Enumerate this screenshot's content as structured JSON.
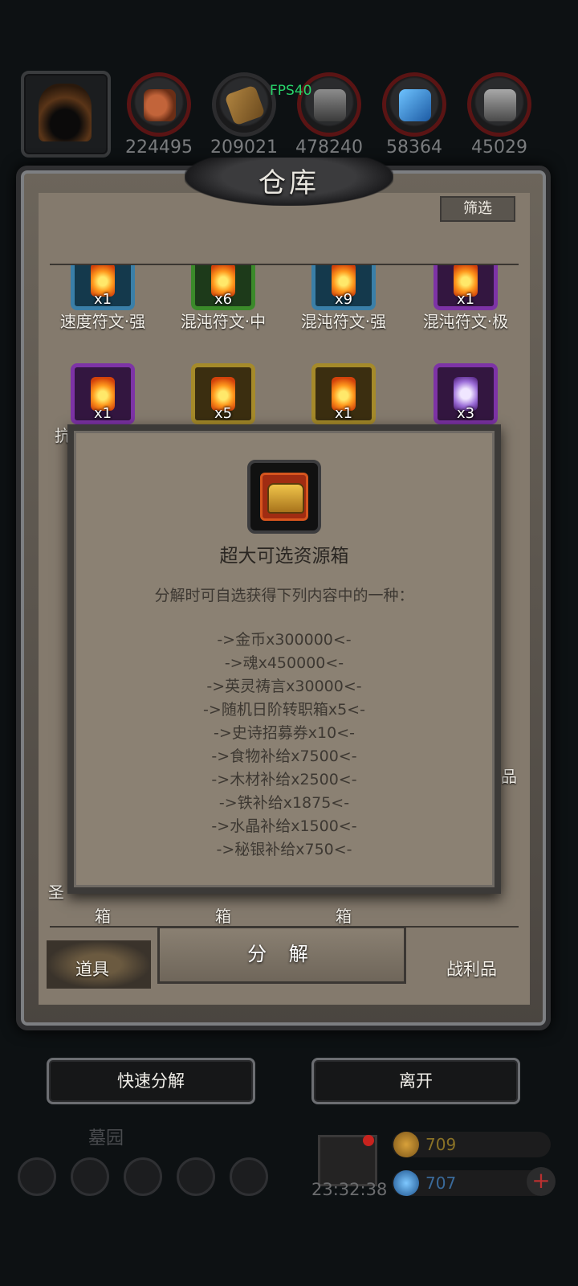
{
  "fps": "FPS40",
  "resources": [
    {
      "icon": "meat-icon",
      "count": "224495"
    },
    {
      "icon": "wood-icon",
      "count": "209021"
    },
    {
      "icon": "iron-icon",
      "count": "478240"
    },
    {
      "icon": "crystal-icon",
      "count": "58364"
    },
    {
      "icon": "mithril-icon",
      "count": "45029"
    }
  ],
  "warehouse": {
    "title": "仓库",
    "filter": "筛选",
    "row1": [
      {
        "label": "速度符文·强",
        "qty": "x1"
      },
      {
        "label": "混沌符文·中",
        "qty": "x6"
      },
      {
        "label": "混沌符文·强",
        "qty": "x9"
      },
      {
        "label": "混沌符文·极",
        "qty": "x1"
      }
    ],
    "row2": [
      {
        "qty": "x1"
      },
      {
        "qty": "x5"
      },
      {
        "qty": "x1"
      },
      {
        "qty": "x3"
      }
    ],
    "row2_partial_label": "抗",
    "side_partial_label": "品",
    "saint_partial": "圣",
    "bottom_row_labels": [
      "箱",
      "箱",
      "箱"
    ],
    "tabs": {
      "items": "道具",
      "decompose": "分 解",
      "loot": "战利品"
    }
  },
  "popup": {
    "title": "超大可选资源箱",
    "description": "分解时可自选获得下列内容中的一种：",
    "rewards": [
      "->金币x300000<-",
      "->魂x450000<-",
      "->英灵祷言x30000<-",
      "->随机日阶转职箱x5<-",
      "->史诗招募券x10<-",
      "->食物补给x7500<-",
      "->木材补给x2500<-",
      "->铁补给x1875<-",
      "->水晶补给x1500<-",
      "->秘银补给x750<-"
    ]
  },
  "actions": {
    "quick_decompose": "快速分解",
    "leave": "离开"
  },
  "hud": {
    "location": "墓园",
    "clock": "23:32:38",
    "gold": "709",
    "gems": "707",
    "plus": "+"
  }
}
